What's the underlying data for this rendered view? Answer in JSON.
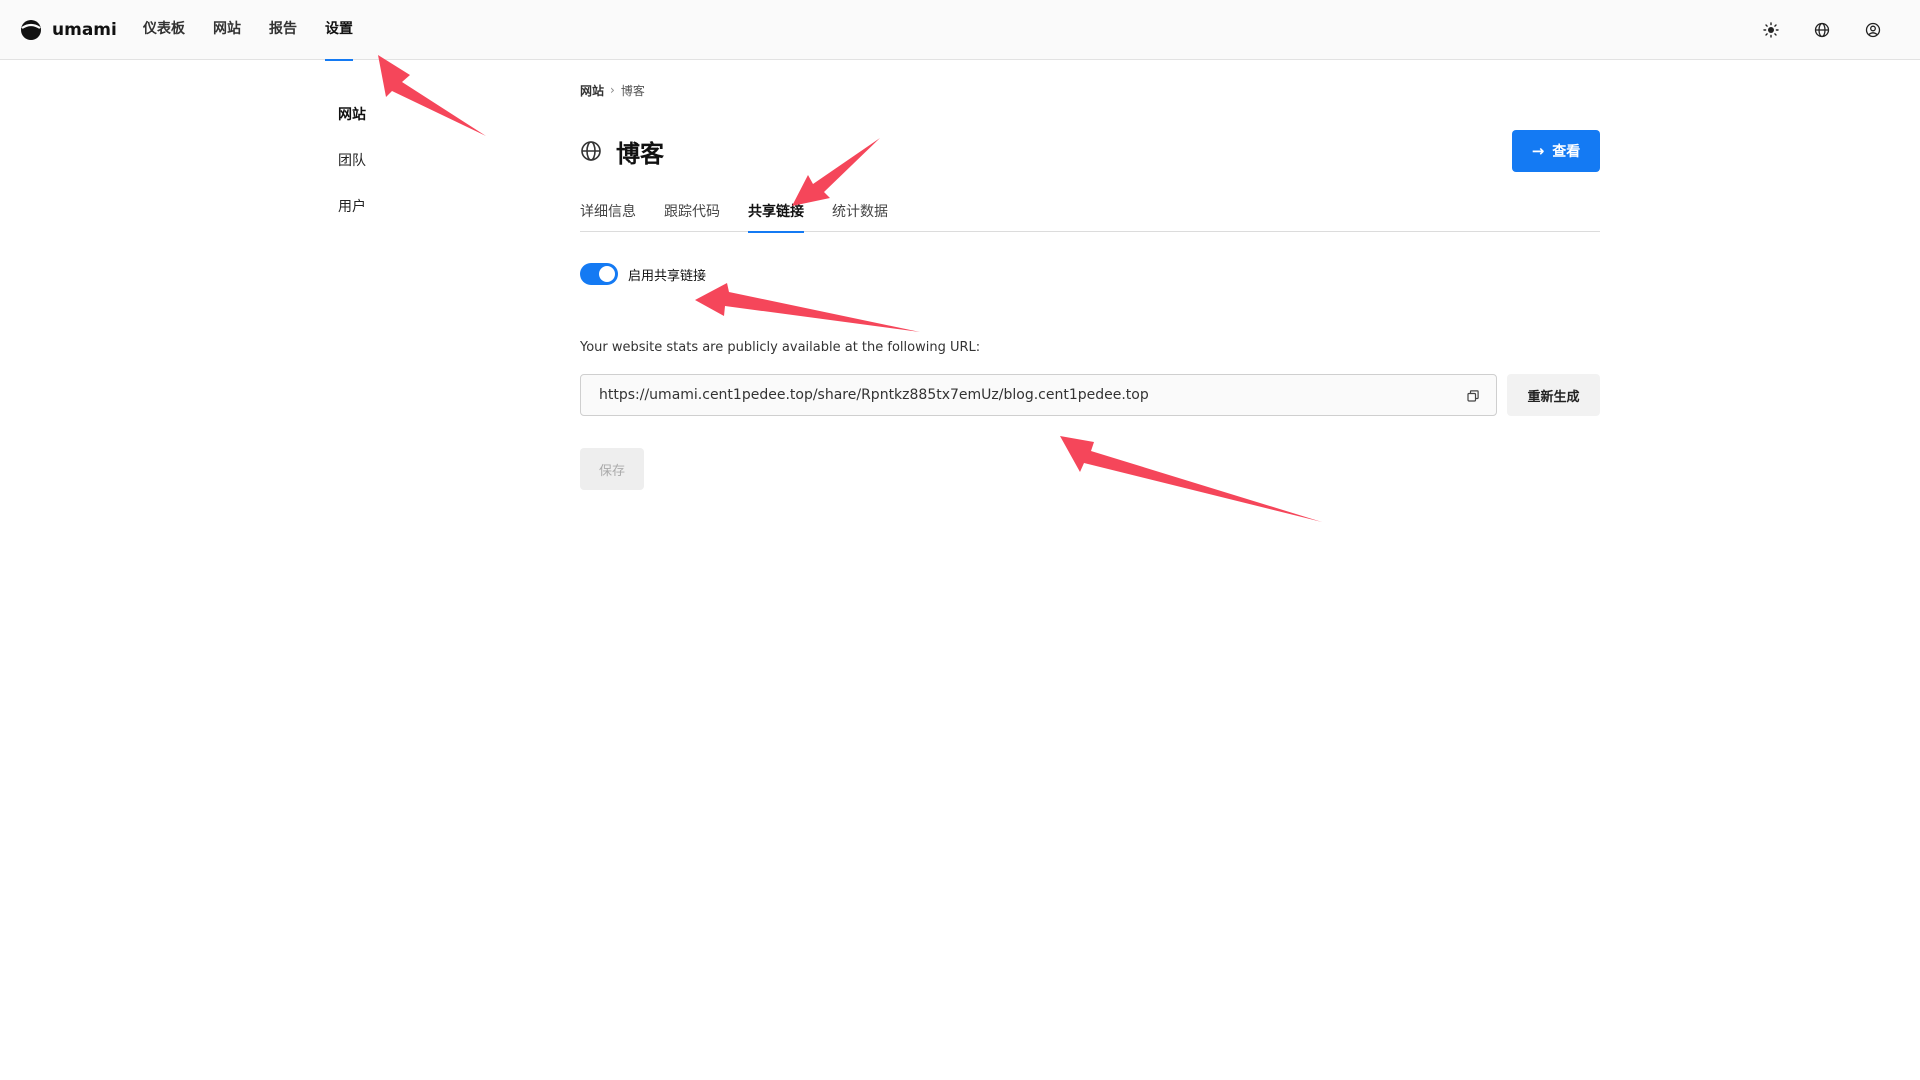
{
  "app": {
    "name": "umami"
  },
  "nav": {
    "items": [
      "仪表板",
      "网站",
      "报告",
      "设置"
    ],
    "active": "设置"
  },
  "top_icons": [
    "sun-icon",
    "globe-icon",
    "user-circle-icon"
  ],
  "sidebar": {
    "items": [
      "网站",
      "团队",
      "用户"
    ],
    "active": "网站"
  },
  "breadcrumb": {
    "parent": "网站",
    "current": "博客"
  },
  "page": {
    "title": "博客",
    "view_button": "查看"
  },
  "tabs": {
    "items": [
      "详细信息",
      "跟踪代码",
      "共享链接",
      "统计数据"
    ],
    "active": "共享链接"
  },
  "share": {
    "toggle_label": "启用共享链接",
    "enabled": true,
    "description": "Your website stats are publicly available at the following URL:",
    "url": "https://umami.cent1pedee.top/share/Rpntkz885tx7emUz/blog.cent1pedee.top",
    "regenerate_button": "重新生成",
    "save_button": "保存"
  },
  "colors": {
    "accent": "#147af3",
    "annotation_arrow": "#f5465a"
  }
}
